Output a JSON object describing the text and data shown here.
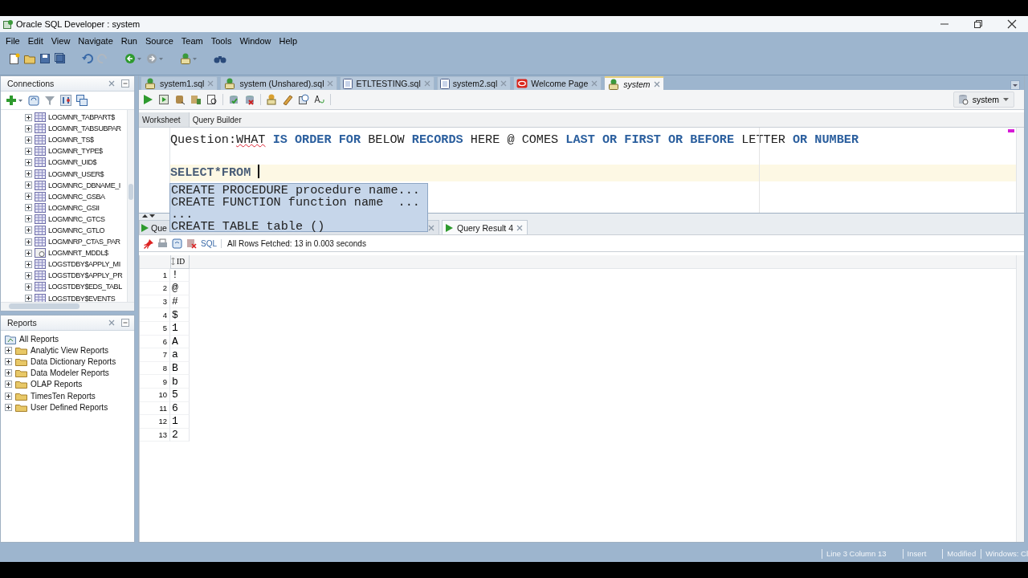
{
  "window": {
    "title": "Oracle SQL Developer : system"
  },
  "menu": [
    "File",
    "Edit",
    "View",
    "Navigate",
    "Run",
    "Source",
    "Team",
    "Tools",
    "Window",
    "Help"
  ],
  "connections": {
    "title": "Connections",
    "items": [
      {
        "label": "LOGMNR_TABPART$",
        "kind": "table"
      },
      {
        "label": "LOGMNR_TABSUBPAR",
        "kind": "table"
      },
      {
        "label": "LOGMNR_TS$",
        "kind": "table"
      },
      {
        "label": "LOGMNR_TYPE$",
        "kind": "table"
      },
      {
        "label": "LOGMNR_UID$",
        "kind": "table"
      },
      {
        "label": "LOGMNR_USER$",
        "kind": "table"
      },
      {
        "label": "LOGMNRC_DBNAME_I",
        "kind": "table"
      },
      {
        "label": "LOGMNRC_GSBA",
        "kind": "table"
      },
      {
        "label": "LOGMNRC_GSII",
        "kind": "table"
      },
      {
        "label": "LOGMNRC_GTCS",
        "kind": "table"
      },
      {
        "label": "LOGMNRC_GTLO",
        "kind": "table"
      },
      {
        "label": "LOGMNRP_CTAS_PAR",
        "kind": "table"
      },
      {
        "label": "LOGMNRT_MDDL$",
        "kind": "view"
      },
      {
        "label": "LOGSTDBY$APPLY_MI",
        "kind": "table"
      },
      {
        "label": "LOGSTDBY$APPLY_PR",
        "kind": "table"
      },
      {
        "label": "LOGSTDBY$EDS_TABL",
        "kind": "table"
      },
      {
        "label": "LOGSTDBY$EVENTS",
        "kind": "table"
      }
    ]
  },
  "reports": {
    "title": "Reports",
    "items": [
      {
        "label": "All Reports",
        "children": [
          {
            "label": "Analytic View Reports"
          },
          {
            "label": "Data Dictionary Reports"
          },
          {
            "label": "Data Modeler Reports"
          },
          {
            "label": "OLAP Reports"
          },
          {
            "label": "TimesTen Reports"
          },
          {
            "label": "User Defined Reports"
          }
        ]
      }
    ]
  },
  "editor_tabs": [
    {
      "label": "system1.sql",
      "kind": "sql",
      "selected": false
    },
    {
      "label": "system (Unshared).sql",
      "kind": "sql",
      "selected": false
    },
    {
      "label": "ETLTESTING.sql",
      "kind": "file",
      "selected": false
    },
    {
      "label": "system2.sql",
      "kind": "file",
      "selected": false
    },
    {
      "label": "Welcome Page",
      "kind": "oracle",
      "selected": false
    },
    {
      "label": "system",
      "kind": "sql",
      "selected": true
    }
  ],
  "connection_selector": "system",
  "worksheet_tabs": [
    {
      "label": "Worksheet",
      "selected": true
    },
    {
      "label": "Query Builder",
      "selected": false
    }
  ],
  "editor": {
    "lines": [
      {
        "kind": "text",
        "current": false,
        "tokens": [
          {
            "text": "Question:",
            "kind": "plain"
          },
          {
            "text": "WHAT",
            "kind": "misspelled"
          },
          {
            "text": "IS",
            "kind": "keyword"
          },
          {
            "text": "ORDER",
            "kind": "keyword"
          },
          {
            "text": "FOR",
            "kind": "keyword"
          },
          {
            "text": "BELOW",
            "kind": "plain"
          },
          {
            "text": "RECORDS",
            "kind": "keyword"
          },
          {
            "text": "HERE",
            "kind": "plain"
          },
          {
            "text": "@",
            "kind": "plain"
          },
          {
            "text": "COMES",
            "kind": "plain"
          },
          {
            "text": "LAST",
            "kind": "keyword"
          },
          {
            "text": "OR",
            "kind": "keyword"
          },
          {
            "text": "FIRST",
            "kind": "keyword"
          },
          {
            "text": "OR",
            "kind": "keyword"
          },
          {
            "text": "BEFORE",
            "kind": "keyword"
          },
          {
            "text": "LETTER",
            "kind": "plain"
          },
          {
            "text": "OR",
            "kind": "keyword"
          },
          {
            "text": "NUMBER",
            "kind": "keyword"
          }
        ]
      },
      {
        "kind": "blank",
        "current": false
      },
      {
        "kind": "text",
        "current": true,
        "tokens": [
          {
            "text": "SELECT*FROM",
            "kind": "statement"
          }
        ]
      }
    ],
    "autocomplete": [
      "CREATE PROCEDURE procedure name...",
      "CREATE FUNCTION function name  ...",
      "...",
      "CREATE TABLE table ()"
    ]
  },
  "result_tabs": [
    {
      "label": "Que",
      "selected": false
    },
    {
      "label": "Query Result 4",
      "selected": true
    }
  ],
  "result_toolbar": {
    "link": "SQL",
    "message": "All Rows Fetched: 13 in 0.003 seconds"
  },
  "grid": {
    "columns": [
      "ID"
    ],
    "rows": [
      {
        "number": "1",
        "value": "!"
      },
      {
        "number": "2",
        "value": "@"
      },
      {
        "number": "3",
        "value": "#"
      },
      {
        "number": "4",
        "value": "$"
      },
      {
        "number": "5",
        "value": "1"
      },
      {
        "number": "6",
        "value": "A"
      },
      {
        "number": "7",
        "value": "a"
      },
      {
        "number": "8",
        "value": "B"
      },
      {
        "number": "9",
        "value": "b"
      },
      {
        "number": "10",
        "value": "5"
      },
      {
        "number": "11",
        "value": "6"
      },
      {
        "number": "12",
        "value": "1"
      },
      {
        "number": "13",
        "value": "2"
      }
    ]
  },
  "status_bar": [
    "Line 3 Column 13",
    "Insert",
    "Modified",
    "Windows: Cl"
  ]
}
